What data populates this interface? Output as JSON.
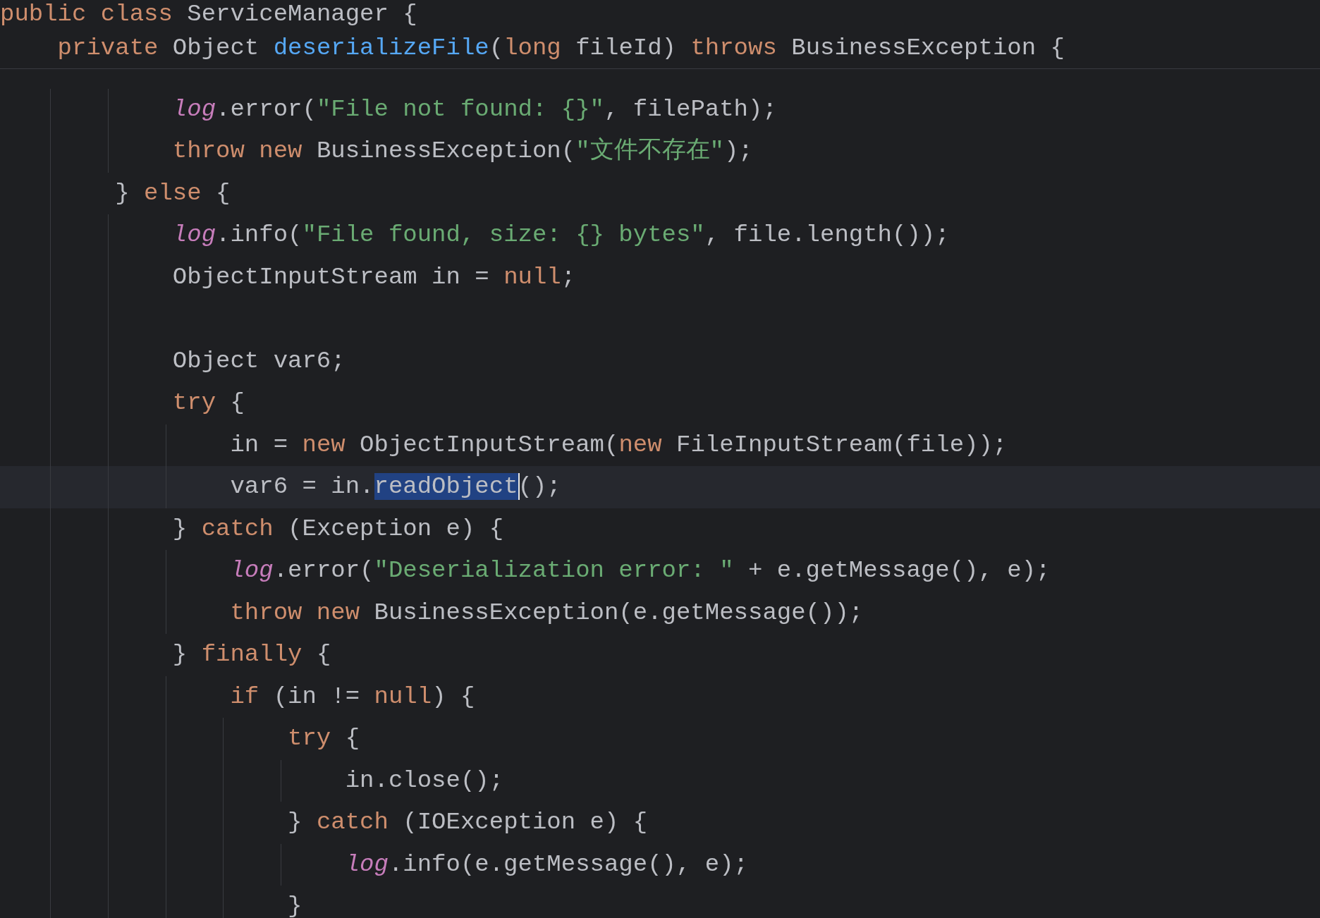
{
  "sticky_header": {
    "lines": [
      {
        "tokens": [
          {
            "text": "public class",
            "kind": "keyword"
          },
          {
            "text": " ServiceManager {",
            "kind": "plain"
          }
        ]
      },
      {
        "tokens": [
          {
            "text": "    private",
            "kind": "keyword"
          },
          {
            "text": " Object ",
            "kind": "plain"
          },
          {
            "text": "deserializeFile",
            "kind": "declaration"
          },
          {
            "text": "(",
            "kind": "plain"
          },
          {
            "text": "long",
            "kind": "keyword"
          },
          {
            "text": " fileId) ",
            "kind": "plain"
          },
          {
            "text": "throws",
            "kind": "keyword"
          },
          {
            "text": " BusinessException {",
            "kind": "plain"
          }
        ]
      }
    ]
  },
  "code": {
    "lines": [
      {
        "kind": "code",
        "current": false,
        "tokens": [
          {
            "text": "            log",
            "kind": "field"
          },
          {
            "text": ".error(",
            "kind": "plain"
          },
          {
            "text": "\"File not found: {}\"",
            "kind": "string"
          },
          {
            "text": ", filePath);",
            "kind": "plain"
          }
        ]
      },
      {
        "kind": "code",
        "current": false,
        "tokens": [
          {
            "text": "            throw new",
            "kind": "keyword"
          },
          {
            "text": " BusinessException(",
            "kind": "plain"
          },
          {
            "text": "\"文件不存在\"",
            "kind": "string"
          },
          {
            "text": ");",
            "kind": "plain"
          }
        ]
      },
      {
        "kind": "code",
        "current": false,
        "tokens": [
          {
            "text": "        } ",
            "kind": "plain"
          },
          {
            "text": "else",
            "kind": "keyword"
          },
          {
            "text": " {",
            "kind": "plain"
          }
        ]
      },
      {
        "kind": "code",
        "current": false,
        "tokens": [
          {
            "text": "            log",
            "kind": "field"
          },
          {
            "text": ".info(",
            "kind": "plain"
          },
          {
            "text": "\"File found, size: {} bytes\"",
            "kind": "string"
          },
          {
            "text": ", file.length());",
            "kind": "plain"
          }
        ]
      },
      {
        "kind": "code",
        "current": false,
        "tokens": [
          {
            "text": "            ObjectInputStream in = ",
            "kind": "plain"
          },
          {
            "text": "null",
            "kind": "keyword"
          },
          {
            "text": ";",
            "kind": "plain"
          }
        ]
      },
      {
        "kind": "blank",
        "current": false
      },
      {
        "kind": "code",
        "current": false,
        "tokens": [
          {
            "text": "            Object var6;",
            "kind": "plain"
          }
        ]
      },
      {
        "kind": "code",
        "current": false,
        "tokens": [
          {
            "text": "            try",
            "kind": "keyword"
          },
          {
            "text": " {",
            "kind": "plain"
          }
        ]
      },
      {
        "kind": "code",
        "current": false,
        "tokens": [
          {
            "text": "                in = ",
            "kind": "plain"
          },
          {
            "text": "new",
            "kind": "keyword"
          },
          {
            "text": " ObjectInputStream(",
            "kind": "plain"
          },
          {
            "text": "new",
            "kind": "keyword"
          },
          {
            "text": " FileInputStream(file));",
            "kind": "plain"
          }
        ]
      },
      {
        "kind": "code",
        "current": true,
        "tokens": [
          {
            "text": "                var6 = in.",
            "kind": "plain",
            "selected": false
          },
          {
            "text": "readObject",
            "kind": "plain",
            "selected": true
          },
          {
            "text": "();",
            "kind": "plain",
            "selected": false
          }
        ]
      },
      {
        "kind": "code",
        "current": false,
        "tokens": [
          {
            "text": "            } ",
            "kind": "plain"
          },
          {
            "text": "catch",
            "kind": "keyword"
          },
          {
            "text": " (Exception e) {",
            "kind": "plain"
          }
        ]
      },
      {
        "kind": "code",
        "current": false,
        "tokens": [
          {
            "text": "                log",
            "kind": "field"
          },
          {
            "text": ".error(",
            "kind": "plain"
          },
          {
            "text": "\"Deserialization error: \"",
            "kind": "string"
          },
          {
            "text": " + e.getMessage(), e);",
            "kind": "plain"
          }
        ]
      },
      {
        "kind": "code",
        "current": false,
        "tokens": [
          {
            "text": "                throw new",
            "kind": "keyword"
          },
          {
            "text": " BusinessException(e.getMessage());",
            "kind": "plain"
          }
        ]
      },
      {
        "kind": "code",
        "current": false,
        "tokens": [
          {
            "text": "            } ",
            "kind": "plain"
          },
          {
            "text": "finally",
            "kind": "keyword"
          },
          {
            "text": " {",
            "kind": "plain"
          }
        ]
      },
      {
        "kind": "code",
        "current": false,
        "tokens": [
          {
            "text": "                if",
            "kind": "keyword"
          },
          {
            "text": " (in != ",
            "kind": "plain"
          },
          {
            "text": "null",
            "kind": "keyword"
          },
          {
            "text": ") {",
            "kind": "plain"
          }
        ]
      },
      {
        "kind": "code",
        "current": false,
        "tokens": [
          {
            "text": "                    try",
            "kind": "keyword"
          },
          {
            "text": " {",
            "kind": "plain"
          }
        ]
      },
      {
        "kind": "code",
        "current": false,
        "tokens": [
          {
            "text": "                        in.close();",
            "kind": "plain"
          }
        ]
      },
      {
        "kind": "code",
        "current": false,
        "tokens": [
          {
            "text": "                    } ",
            "kind": "plain"
          },
          {
            "text": "catch",
            "kind": "keyword"
          },
          {
            "text": " (IOException e) {",
            "kind": "plain"
          }
        ]
      },
      {
        "kind": "code",
        "current": false,
        "tokens": [
          {
            "text": "                        log",
            "kind": "field"
          },
          {
            "text": ".info(e.getMessage(), e);",
            "kind": "plain"
          }
        ]
      },
      {
        "kind": "code",
        "current": false,
        "tokens": [
          {
            "text": "                    }",
            "kind": "plain"
          }
        ]
      }
    ]
  }
}
